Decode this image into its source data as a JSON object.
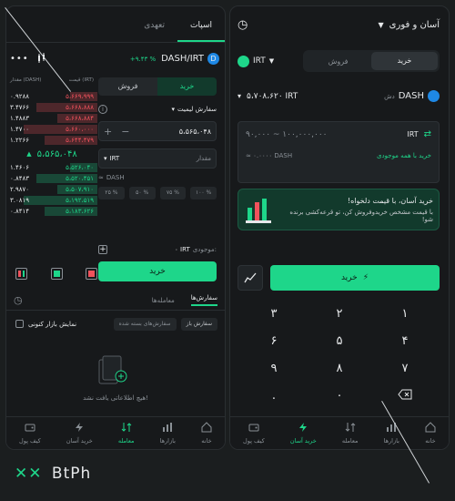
{
  "left": {
    "tabs": [
      {
        "label": "اسپات"
      },
      {
        "label": "تعهدی"
      }
    ],
    "market": {
      "pair": "DASH/IRT",
      "change": "+۹.۴۳ %"
    },
    "orderbook_headers": {
      "price": "قیمت (IRT)",
      "amount": "مقدار (DASH)"
    },
    "asks": [
      {
        "price": "۵،۶۶۹،۹۹۹",
        "amount": "۰.۹۲۸۸"
      },
      {
        "price": "۵،۶۶۸،۸۸۸",
        "amount": "۳.۴۷۶۶"
      },
      {
        "price": "۵،۶۶۸،۸۸۴",
        "amount": "۱.۴۸۸۳"
      },
      {
        "price": "۵،۶۶۰،۰۰۰",
        "amount": "۱.۴۷۰۰"
      },
      {
        "price": "۵،۶۴۴،۴۷۹",
        "amount": "۱.۲۲۶۶"
      }
    ],
    "mid_price": "۵،۵۶۵،۰۴۸",
    "bids": [
      {
        "price": "۵،۵۲۶،۰۴۰",
        "amount": "۱.۴۶۰۶"
      },
      {
        "price": "۵،۵۲۰،۴۵۱",
        "amount": "۰.۸۴۸۳"
      },
      {
        "price": "۵،۵۰۷،۹۱۰",
        "amount": "۲.۹۸۷۰"
      },
      {
        "price": "۵،۱۹۲،۵۱۹",
        "amount": "۳.۰۸۱۹"
      },
      {
        "price": "۵،۱۸۳،۶۲۶",
        "amount": "۰.۸۴۱۴"
      }
    ],
    "side_tabs": {
      "buy": "خرید",
      "sell": "فروش"
    },
    "order_type": "سفارش لیمیت",
    "price_value": "۵،۵۶۵،۰۴۸",
    "price_unit": "IRT",
    "amount_placeholder": "مقدار",
    "amount_unit": "DASH",
    "percents": [
      "۲۵ %",
      "۵۰ %",
      "۷۵ %",
      "۱۰۰ %"
    ],
    "balance_label": "موجودی:",
    "balance_value": "۰ IRT",
    "buy_button": "خرید",
    "orders_tabs": {
      "my_orders": "سفارش‌ها",
      "trades": "معامله‌ها"
    },
    "show_current_market": "نمایش بازار کنونی",
    "filters": {
      "open": "سفارش باز",
      "closed": "سفارش‌های بسته شده"
    },
    "empty_text": "هیچ اطلاعاتی یافت نشد!",
    "nav": [
      {
        "label": "خانه",
        "icon": "home-icon"
      },
      {
        "label": "بازارها",
        "icon": "markets-icon"
      },
      {
        "label": "معامله",
        "icon": "trade-icon"
      },
      {
        "label": "خرید آسان",
        "icon": "easy-buy-icon"
      },
      {
        "label": "کیف پول",
        "icon": "wallet-icon"
      }
    ]
  },
  "right": {
    "title": "آسان و فوری",
    "currency": "IRT",
    "side_tabs": {
      "buy": "خرید",
      "sell": "فروش"
    },
    "coin": {
      "symbol": "DASH",
      "name": "دش",
      "price": "۵،۷۰۸،۶۲۰ IRT"
    },
    "amount_range": "۹۰,۰۰۰ ~ ۱۰۰,۰۰۰,۰۰۰",
    "amount_unit": "IRT",
    "receive": "≈ ۰.۰۰۰۰ DASH",
    "buy_all_balance": "خرید با همه موجودی",
    "promo": {
      "title": "خرید آسان، با قیمت دلخواه!",
      "desc": "با قیمت مشخص خریدوفروش کن، تو قرعه‌کشی برنده شو!"
    },
    "buy_button": "خرید",
    "keypad": [
      "۱",
      "۲",
      "۳",
      "۴",
      "۵",
      "۶",
      "۷",
      "۸",
      "۹",
      ".",
      "۰"
    ],
    "nav": [
      {
        "label": "خانه",
        "icon": "home-icon"
      },
      {
        "label": "بازارها",
        "icon": "markets-icon"
      },
      {
        "label": "معامله",
        "icon": "trade-icon"
      },
      {
        "label": "خرید آسان",
        "icon": "easy-buy-icon"
      },
      {
        "label": "کیف پول",
        "icon": "wallet-icon"
      }
    ]
  },
  "footer": {
    "logo": "BtPh"
  },
  "colors": {
    "accent": "#1ed68a",
    "ask": "#f0525c",
    "bid": "#1ed68a",
    "bg": "#17191b"
  }
}
